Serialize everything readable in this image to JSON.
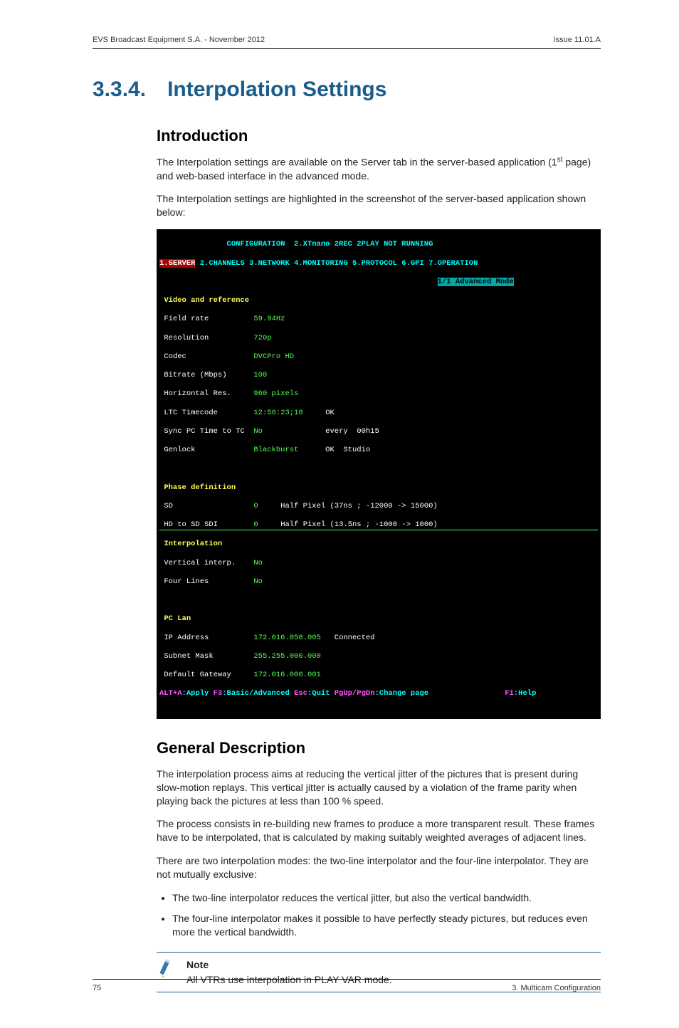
{
  "header": {
    "left": "EVS Broadcast Equipment S.A. - November 2012",
    "right": "Issue 11.01.A"
  },
  "section": {
    "number": "3.3.4.",
    "title": "Interpolation Settings"
  },
  "intro": {
    "heading": "Introduction",
    "p1_a": "The Interpolation settings are available on the Server tab in the server-based application (1",
    "p1_sup": "st",
    "p1_b": " page) and web-based interface in the advanced mode.",
    "p2": "The Interpolation settings are highlighted in the screenshot of the server-based application shown below:"
  },
  "terminal": {
    "title_left": "CONFIGURATION",
    "title_right": "2.XTnano 2REC 2PLAY NOT RUNNING",
    "tabs": {
      "active": "1.SERVER",
      "rest": " 2.CHANNELS 3.NETWORK 4.MONITORING 5.PROTOCOL 6.GPI 7.OPERATION"
    },
    "mode_line": "1/1 Advanced Mode",
    "groups": {
      "video_ref": "Video and reference",
      "phase_def": "Phase definition",
      "interp": "Interpolation",
      "pc_lan": "PC Lan"
    },
    "rows": {
      "field_rate": {
        "label": "Field rate",
        "value": "59.94Hz"
      },
      "resolution": {
        "label": "Resolution",
        "value": "720p"
      },
      "codec": {
        "label": "Codec",
        "value": "DVCPro HD"
      },
      "bitrate": {
        "label": "Bitrate (Mbps)",
        "value": "100"
      },
      "hres": {
        "label": "Horizontal Res.",
        "value": "960 pixels"
      },
      "ltc": {
        "label": "LTC Timecode",
        "value": "12:56:23;18",
        "extra": "OK"
      },
      "sync": {
        "label": "Sync PC Time to TC",
        "value": "No",
        "extra": "every  00h15"
      },
      "genlock": {
        "label": "Genlock",
        "value": "Blackburst",
        "extra": "OK  Studio"
      },
      "sd": {
        "label": "SD",
        "value": "0",
        "extra": "Half Pixel (37ns ; -12000 -> 15000)"
      },
      "hd_to_sd": {
        "label": "HD to SD SDI",
        "value": "0",
        "extra": "Half Pixel (13.5ns ; -1000 -> 1000)"
      },
      "vinterp": {
        "label": "Vertical interp.",
        "value": "No"
      },
      "fourlines": {
        "label": "Four Lines",
        "value": "No"
      },
      "ip": {
        "label": "IP Address",
        "value": "172.016.058.005",
        "extra": "Connected"
      },
      "subnet": {
        "label": "Subnet Mask",
        "value": "255.255.000.000"
      },
      "gateway": {
        "label": "Default Gateway",
        "value": "172.016.000.001"
      }
    },
    "footer": {
      "k1": "ALT+A",
      "v1": ":Apply ",
      "k2": "F3",
      "v2": ":Basic/Advanced ",
      "k3": "Esc",
      "v3": ":Quit ",
      "k4": "PgUp/PgDn",
      "v4": ":Change page",
      "k5": "F1",
      "v5": ":Help"
    }
  },
  "general": {
    "heading": "General Description",
    "p1": "The interpolation process aims at reducing the vertical jitter of the pictures that is present during slow-motion replays. This vertical jitter is actually caused by a violation of the frame parity when playing back the pictures at less than 100 % speed.",
    "p2": "The process consists in re-building new frames to produce a more transparent result. These frames have to be interpolated, that is calculated by making suitably weighted averages of adjacent lines.",
    "p3": "There are two interpolation modes: the two-line interpolator and the four-line interpolator. They are not mutually exclusive:",
    "li1": "The two-line interpolator reduces the vertical jitter, but also the vertical bandwidth.",
    "li2": "The four-line interpolator makes it possible to have perfectly steady pictures, but reduces even more the vertical bandwidth."
  },
  "note": {
    "head": "Note",
    "body": "All VTRs use interpolation in PLAY VAR mode."
  },
  "footer": {
    "left": "75",
    "right": "3. Multicam Configuration"
  }
}
